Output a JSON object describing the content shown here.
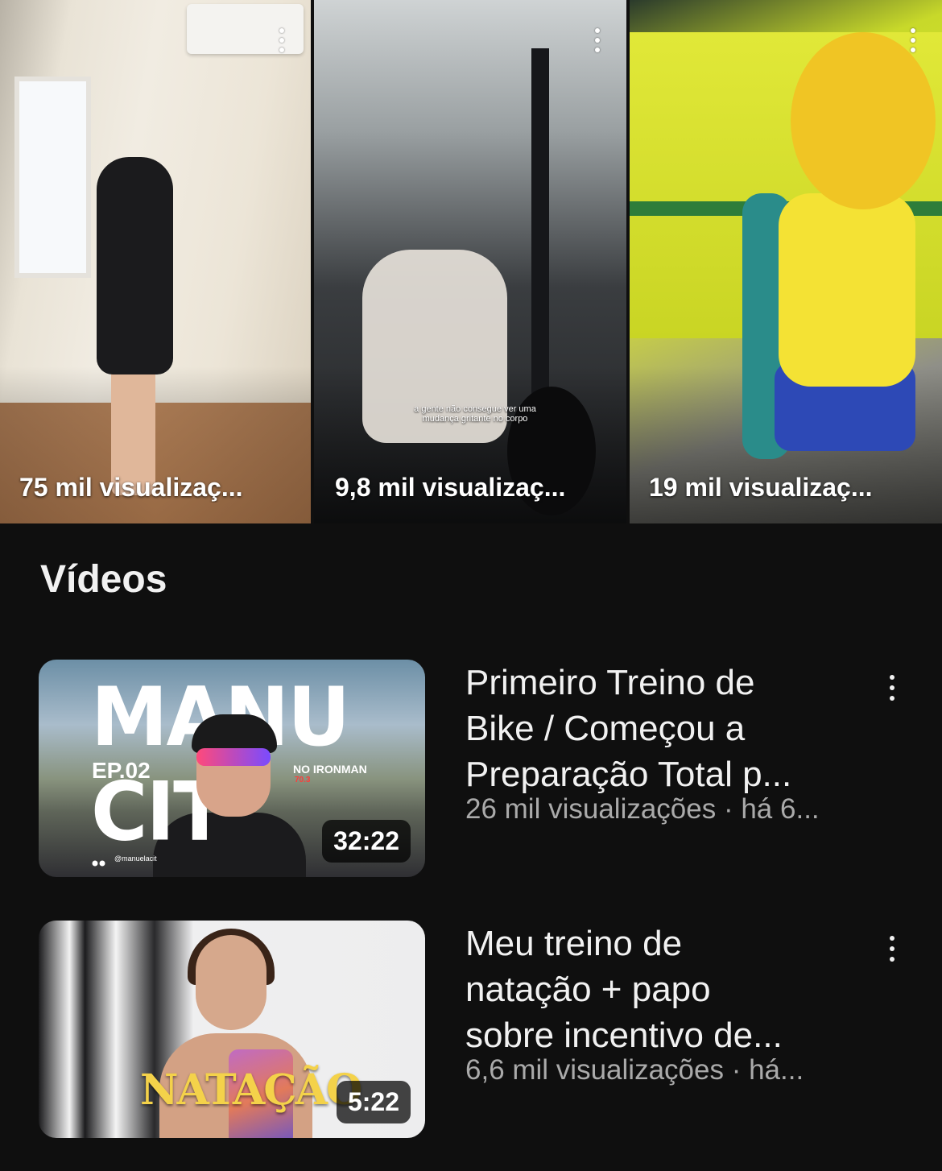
{
  "shorts": [
    {
      "views": "75 mil visualizaç..."
    },
    {
      "views": "9,8 mil visualizaç...",
      "caption": "a gente não consegue ver uma mudança gritante no corpo"
    },
    {
      "views": "19 mil visualizaç..."
    }
  ],
  "section": {
    "title": "Vídeos"
  },
  "videos": [
    {
      "title_lines": [
        "Primeiro Treino de",
        "Bike / Começou a",
        "Preparação Total p..."
      ],
      "meta": "26 mil visualizações · há 6...",
      "duration": "32:22",
      "thumb_text": {
        "big": "MANU CIT",
        "ep": "EP.02",
        "ironman": "NO IRONMAN",
        "ironman_sub": "70.3",
        "handle": "@manuelacit"
      }
    },
    {
      "title_lines": [
        "Meu treino de",
        "natação + papo",
        "sobre incentivo de..."
      ],
      "meta": "6,6 mil visualizações · há...",
      "duration": "5:22",
      "thumb_text": {
        "word": "NATAÇÃO"
      }
    }
  ],
  "icons": {
    "more": "more-vert-icon"
  },
  "colors": {
    "background": "#0f0f0f",
    "text": "#f1f1f1",
    "meta": "#aaaaaa"
  }
}
